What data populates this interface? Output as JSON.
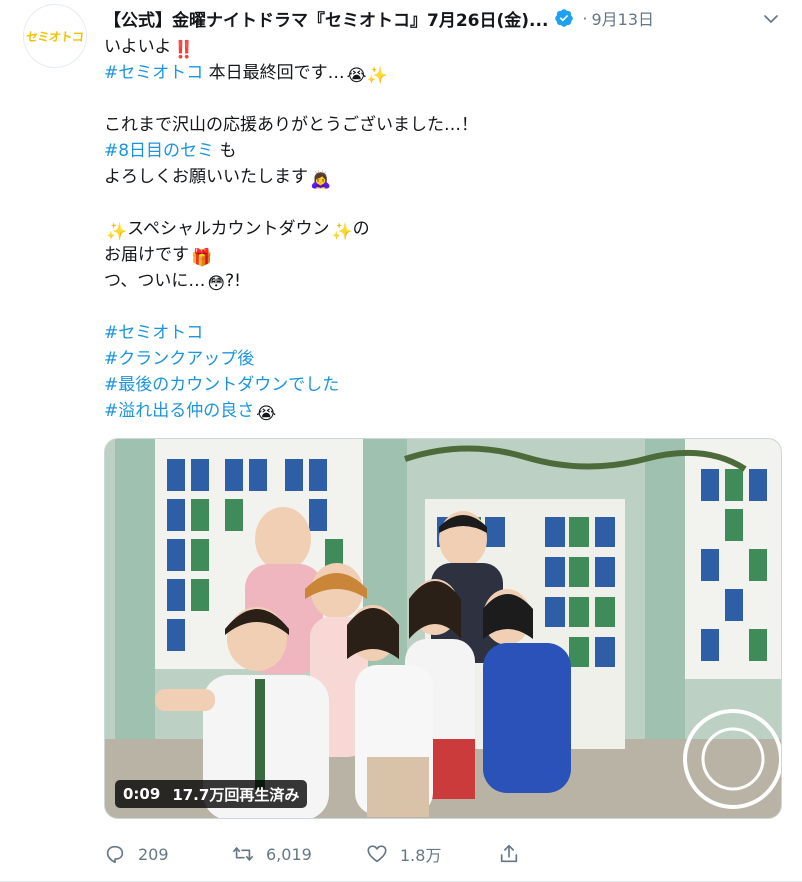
{
  "tweet": {
    "avatar_text": "セミオトコ",
    "author_name": "【公式】金曜ナイトドラマ『セミオトコ』7月26日(金)...",
    "separator": "·",
    "timestamp": "9月13日",
    "lines": [
      {
        "text": "いよいよ",
        "emoji": "‼️"
      },
      {
        "hashtag": "#セミオトコ",
        "text": " 本日最終回です…",
        "emoji": "😭✨"
      },
      {
        "text": "これまで沢山の応援ありがとうございました…！"
      },
      {
        "hashtag": "#8日目のセミ",
        "text": " も"
      },
      {
        "text": "よろしくお願いいたします",
        "emoji": "🙇‍♀️"
      },
      {
        "emoji_before": "✨",
        "text": "スペシャルカウントダウン",
        "emoji": "✨",
        "text2": "の"
      },
      {
        "text": "お届けです",
        "emoji": "🎁"
      },
      {
        "text": "つ、ついに…",
        "emoji": "😳",
        "text2": "?!"
      },
      {
        "hashtag": "#セミオトコ"
      },
      {
        "hashtag": "#クランクアップ後"
      },
      {
        "hashtag": "#最後のカウントダウンでした"
      },
      {
        "hashtag": "#溢れ出る仲の良さ",
        "emoji": "😭"
      }
    ],
    "video": {
      "duration": "0:09",
      "views": "17.7万回再生済み"
    },
    "actions": {
      "reply_count": "209",
      "retweet_count": "6,019",
      "like_count": "1.8万"
    },
    "colors": {
      "hashtag": "#1b95e0",
      "secondary": "#657786",
      "verified": "#1da1f2"
    }
  }
}
